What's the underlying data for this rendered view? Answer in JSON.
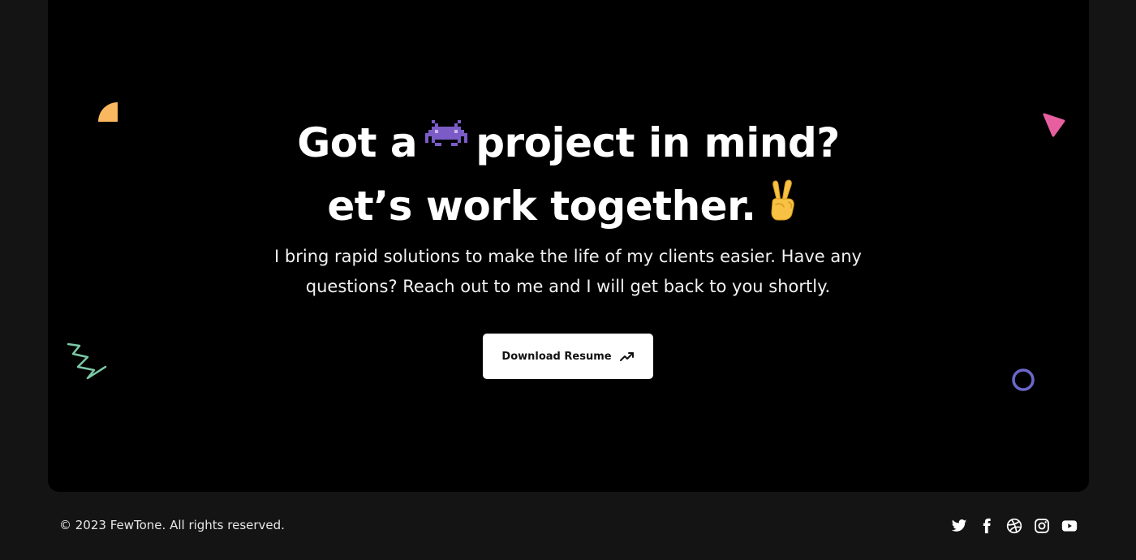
{
  "hero": {
    "headline_part1": "Got a",
    "headline_part2": "project in mind?",
    "headline_line2": "et’s work together.",
    "subtext": "I bring rapid solutions to make the life of my clients easier. Have any questions? Reach out to me and I will get back to you shortly.",
    "emoji_1": "space-invader-icon",
    "emoji_2": "victory-hand-icon",
    "button_label": "Download Resume"
  },
  "decorations": {
    "quarter_circle_color": "#F9B860",
    "triangle_color": "#E85FA0",
    "zigzag_color": "#7CC9A6",
    "ring_color": "#6B68C9"
  },
  "footer": {
    "copyright": "© 2023 FewTone. All rights reserved.",
    "social_icons": [
      "twitter-icon",
      "facebook-icon",
      "dribbble-icon",
      "instagram-icon",
      "youtube-icon"
    ]
  }
}
